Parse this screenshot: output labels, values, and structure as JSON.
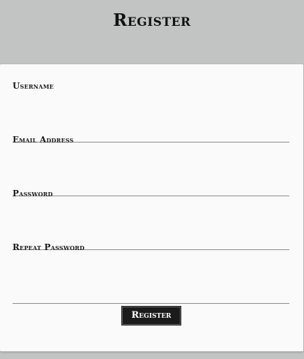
{
  "header": {
    "title": "Register"
  },
  "form": {
    "fields": [
      {
        "label": "Username",
        "value": "",
        "type": "text"
      },
      {
        "label": "Email Address",
        "value": "",
        "type": "email"
      },
      {
        "label": "Password",
        "value": "",
        "type": "password"
      },
      {
        "label": "Repeat Password",
        "value": "",
        "type": "password"
      }
    ],
    "submit_label": "Register"
  },
  "colors": {
    "background": "#c2c4c3",
    "card": "#fafafa",
    "button": "#1b1b1b",
    "button_text": "#ffffff"
  }
}
